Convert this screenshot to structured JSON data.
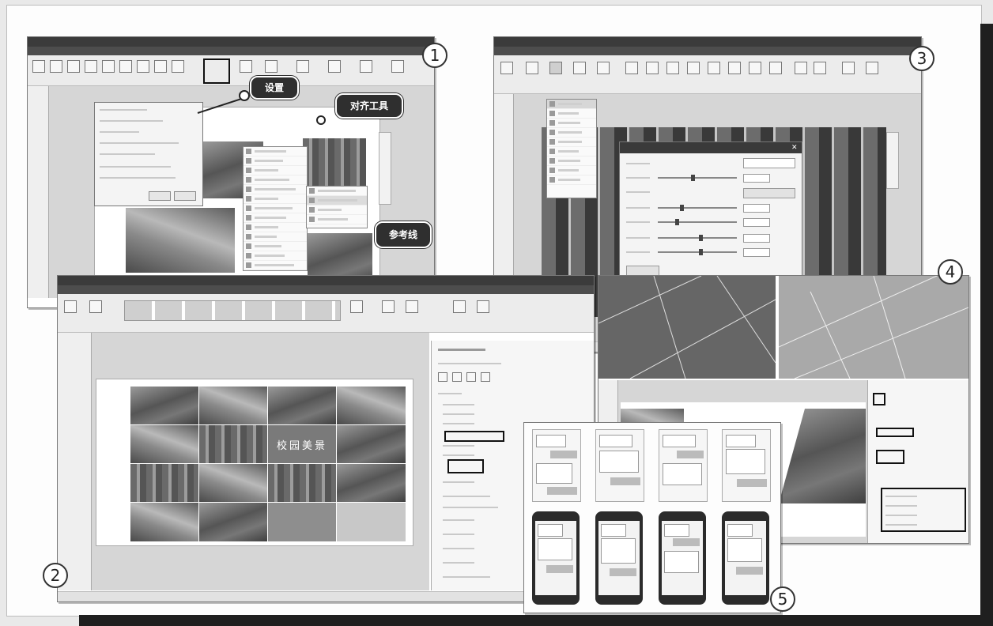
{
  "figure": {
    "panel_numbers": [
      "1",
      "2",
      "3",
      "4",
      "5"
    ],
    "callouts": {
      "settings": "设置",
      "align_tool": "对齐工具",
      "guide_lines": "参考线"
    },
    "panel2_slide_caption": "校园美景"
  },
  "icons": {
    "callout_pointer": "callout-arrow-icon",
    "settings_dot": "settings-dot-icon"
  },
  "colors": {
    "titlebar": "#3b3b3b",
    "callout_bg": "#2f2f2f",
    "frame_shadow": "#1f1f1f",
    "highlight_border": "#111111"
  }
}
